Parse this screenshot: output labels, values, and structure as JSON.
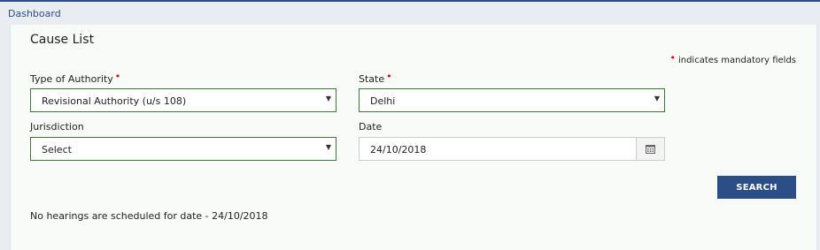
{
  "breadcrumb": {
    "dashboard": "Dashboard"
  },
  "page": {
    "title": "Cause List",
    "mandatory_note": "indicates mandatory fields",
    "required_marker": "•"
  },
  "form": {
    "type_of_authority": {
      "label": "Type of Authority",
      "value": "Revisional Authority (u/s 108)",
      "required": true
    },
    "state": {
      "label": "State",
      "value": "Delhi",
      "required": true
    },
    "jurisdiction": {
      "label": "Jurisdiction",
      "value": "Select",
      "required": false
    },
    "date": {
      "label": "Date",
      "value": "24/10/2018",
      "icon": "calendar-icon"
    }
  },
  "actions": {
    "search_label": "SEARCH"
  },
  "result": {
    "message": "No hearings are scheduled for date - 24/10/2018"
  },
  "colors": {
    "brand": "#2c4e86",
    "field_border": "#3d7a3a",
    "required": "#e00000"
  }
}
